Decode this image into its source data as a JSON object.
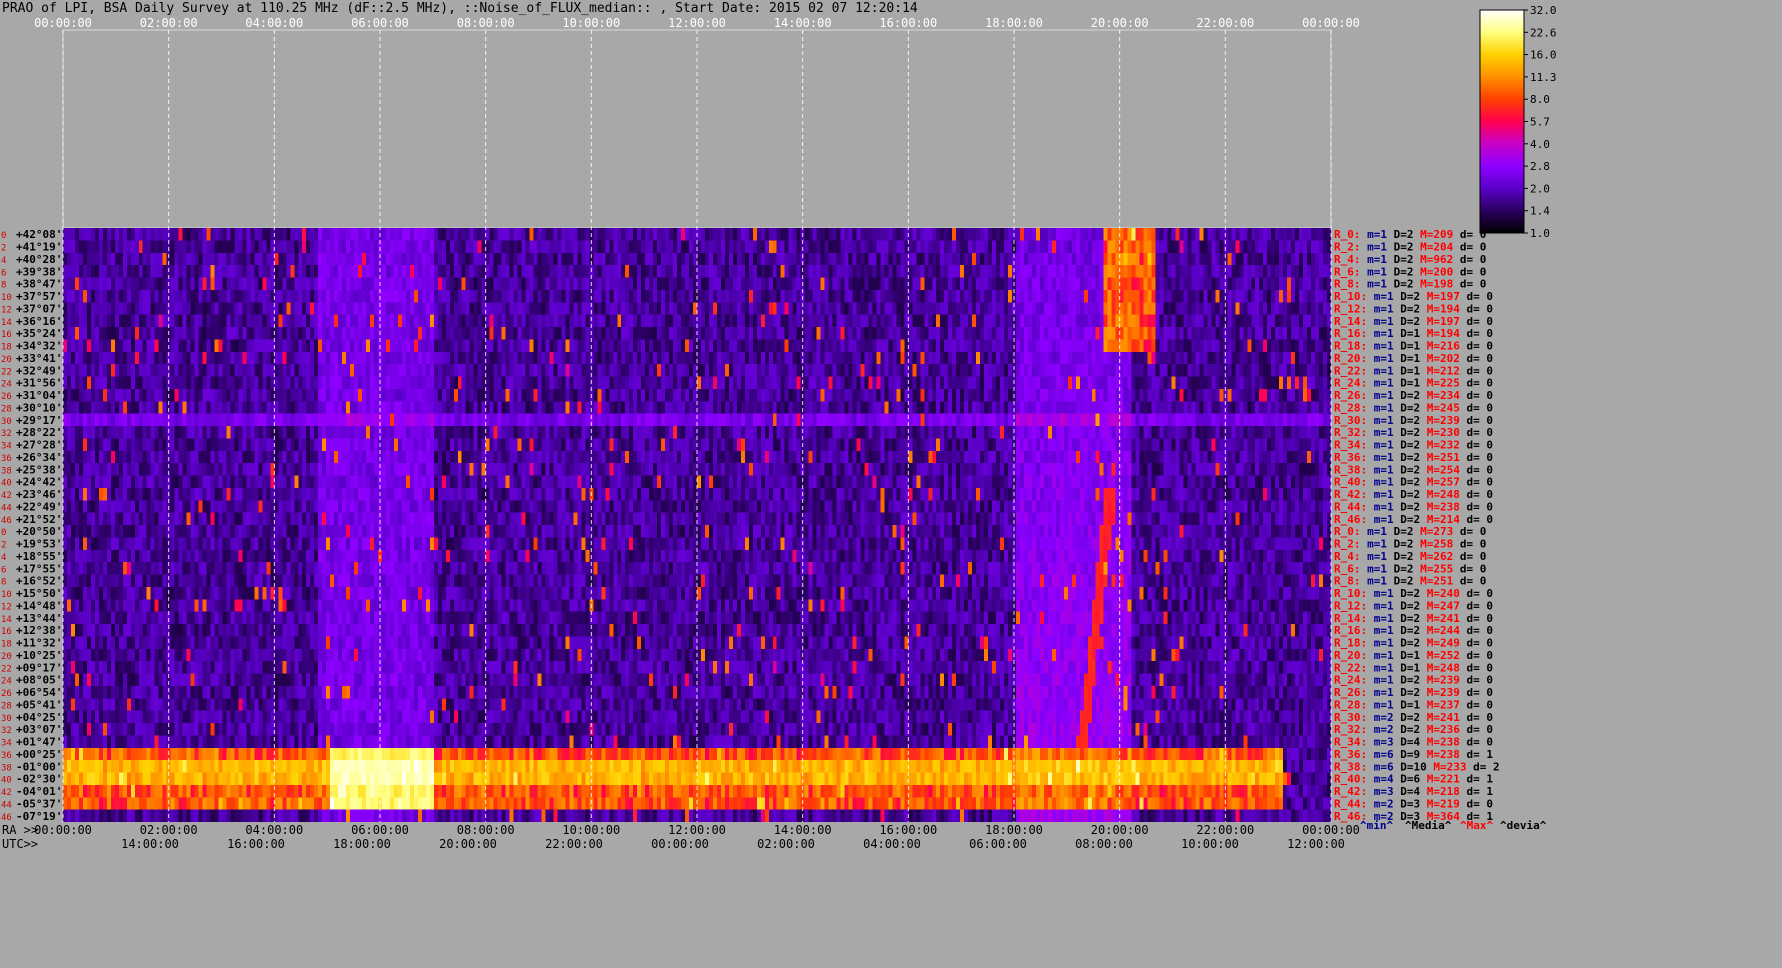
{
  "header": {
    "title": "PRAO of LPI, BSA Daily Survey at 110.25 MHz (dF::2.5 MHz), ::Noise_of_FLUX_median:: , Start Date: 2015 02 07 12:20:14"
  },
  "chart_data": {
    "type": "heatmap",
    "title": "PRAO of LPI, BSA Daily Survey at 110.25 MHz (dF::2.5 MHz), ::Noise_of_FLUX_median:: , Start Date: 2015 02 07 12:20:14",
    "x_top_ticks": [
      "00:00:00",
      "02:00:00",
      "04:00:00",
      "06:00:00",
      "08:00:00",
      "10:00:00",
      "12:00:00",
      "14:00:00",
      "16:00:00",
      "18:00:00",
      "20:00:00",
      "22:00:00",
      "00:00:00"
    ],
    "x_ra_prefix": "RA >>",
    "x_ra_ticks": [
      "00:00:00",
      "02:00:00",
      "04:00:00",
      "06:00:00",
      "08:00:00",
      "10:00:00",
      "12:00:00",
      "14:00:00",
      "16:00:00",
      "18:00:00",
      "20:00:00",
      "22:00:00",
      "00:00:00"
    ],
    "x_utc_prefix": "UTC>>",
    "x_utc_ticks": [
      "14:00:00",
      "16:00:00",
      "18:00:00",
      "20:00:00",
      "22:00:00",
      "00:00:00",
      "02:00:00",
      "04:00:00",
      "06:00:00",
      "08:00:00",
      "10:00:00",
      "12:00:00"
    ],
    "declinations": [
      "+42°08'",
      "+41°19'",
      "+40°28'",
      "+39°38'",
      "+38°47'",
      "+37°57'",
      "+37°07'",
      "+36°16'",
      "+35°24'",
      "+34°32'",
      "+33°41'",
      "+32°49'",
      "+31°56'",
      "+31°04'",
      "+30°10'",
      "+29°17'",
      "+28°22'",
      "+27°28'",
      "+26°34'",
      "+25°38'",
      "+24°42'",
      "+23°46'",
      "+22°49'",
      "+21°52'",
      "+20°50'",
      "+19°53'",
      "+18°55'",
      "+17°55'",
      "+16°52'",
      "+15°50'",
      "+14°48'",
      "+13°44'",
      "+12°38'",
      "+11°32'",
      "+10°25'",
      "+09°17'",
      "+08°05'",
      "+06°54'",
      "+05°41'",
      "+04°25'",
      "+03°07'",
      "+01°47'",
      "+00°25'",
      "-01°00'",
      "-02°30'",
      "-04°01'",
      "-05°37'",
      "-07°19'"
    ],
    "row_index_labels": [
      "0",
      "2",
      "4",
      "6",
      "8",
      "10",
      "12",
      "14",
      "16",
      "18",
      "20",
      "22",
      "24",
      "26",
      "28",
      "30",
      "32",
      "34",
      "36",
      "38",
      "40",
      "42",
      "44",
      "46",
      "0",
      "2",
      "4",
      "6",
      "8",
      "10",
      "12",
      "14",
      "16",
      "18",
      "20",
      "22",
      "24",
      "26",
      "28",
      "30",
      "32",
      "34",
      "36",
      "38",
      "40",
      "42",
      "44",
      "46"
    ],
    "row_stats": [
      {
        "r": "R_0:",
        "m": "m=1",
        "D": "D=2",
        "M": "M=209",
        "d": "d= 0"
      },
      {
        "r": "R_2:",
        "m": "m=1",
        "D": "D=2",
        "M": "M=204",
        "d": "d= 0"
      },
      {
        "r": "R_4:",
        "m": "m=1",
        "D": "D=2",
        "M": "M=962",
        "d": "d= 0"
      },
      {
        "r": "R_6:",
        "m": "m=1",
        "D": "D=2",
        "M": "M=200",
        "d": "d= 0"
      },
      {
        "r": "R_8:",
        "m": "m=1",
        "D": "D=2",
        "M": "M=198",
        "d": "d= 0"
      },
      {
        "r": "R_10:",
        "m": "m=1",
        "D": "D=2",
        "M": "M=197",
        "d": "d= 0"
      },
      {
        "r": "R_12:",
        "m": "m=1",
        "D": "D=2",
        "M": "M=194",
        "d": "d= 0"
      },
      {
        "r": "R_14:",
        "m": "m=1",
        "D": "D=2",
        "M": "M=197",
        "d": "d= 0"
      },
      {
        "r": "R_16:",
        "m": "m=1",
        "D": "D=1",
        "M": "M=194",
        "d": "d= 0"
      },
      {
        "r": "R_18:",
        "m": "m=1",
        "D": "D=1",
        "M": "M=216",
        "d": "d= 0"
      },
      {
        "r": "R_20:",
        "m": "m=1",
        "D": "D=1",
        "M": "M=202",
        "d": "d= 0"
      },
      {
        "r": "R_22:",
        "m": "m=1",
        "D": "D=1",
        "M": "M=212",
        "d": "d= 0"
      },
      {
        "r": "R_24:",
        "m": "m=1",
        "D": "D=1",
        "M": "M=225",
        "d": "d= 0"
      },
      {
        "r": "R_26:",
        "m": "m=1",
        "D": "D=2",
        "M": "M=234",
        "d": "d= 0"
      },
      {
        "r": "R_28:",
        "m": "m=1",
        "D": "D=2",
        "M": "M=245",
        "d": "d= 0"
      },
      {
        "r": "R_30:",
        "m": "m=1",
        "D": "D=2",
        "M": "M=239",
        "d": "d= 0"
      },
      {
        "r": "R_32:",
        "m": "m=1",
        "D": "D=2",
        "M": "M=230",
        "d": "d= 0"
      },
      {
        "r": "R_34:",
        "m": "m=1",
        "D": "D=2",
        "M": "M=232",
        "d": "d= 0"
      },
      {
        "r": "R_36:",
        "m": "m=1",
        "D": "D=2",
        "M": "M=251",
        "d": "d= 0"
      },
      {
        "r": "R_38:",
        "m": "m=1",
        "D": "D=2",
        "M": "M=254",
        "d": "d= 0"
      },
      {
        "r": "R_40:",
        "m": "m=1",
        "D": "D=2",
        "M": "M=257",
        "d": "d= 0"
      },
      {
        "r": "R_42:",
        "m": "m=1",
        "D": "D=2",
        "M": "M=248",
        "d": "d= 0"
      },
      {
        "r": "R_44:",
        "m": "m=1",
        "D": "D=2",
        "M": "M=238",
        "d": "d= 0"
      },
      {
        "r": "R_46:",
        "m": "m=1",
        "D": "D=2",
        "M": "M=214",
        "d": "d= 0"
      },
      {
        "r": "R_0:",
        "m": "m=1",
        "D": "D=2",
        "M": "M=273",
        "d": "d= 0"
      },
      {
        "r": "R_2:",
        "m": "m=1",
        "D": "D=2",
        "M": "M=258",
        "d": "d= 0"
      },
      {
        "r": "R_4:",
        "m": "m=1",
        "D": "D=2",
        "M": "M=262",
        "d": "d= 0"
      },
      {
        "r": "R_6:",
        "m": "m=1",
        "D": "D=2",
        "M": "M=255",
        "d": "d= 0"
      },
      {
        "r": "R_8:",
        "m": "m=1",
        "D": "D=2",
        "M": "M=251",
        "d": "d= 0"
      },
      {
        "r": "R_10:",
        "m": "m=1",
        "D": "D=2",
        "M": "M=240",
        "d": "d= 0"
      },
      {
        "r": "R_12:",
        "m": "m=1",
        "D": "D=2",
        "M": "M=247",
        "d": "d= 0"
      },
      {
        "r": "R_14:",
        "m": "m=1",
        "D": "D=2",
        "M": "M=241",
        "d": "d= 0"
      },
      {
        "r": "R_16:",
        "m": "m=1",
        "D": "D=2",
        "M": "M=244",
        "d": "d= 0"
      },
      {
        "r": "R_18:",
        "m": "m=1",
        "D": "D=2",
        "M": "M=249",
        "d": "d= 0"
      },
      {
        "r": "R_20:",
        "m": "m=1",
        "D": "D=1",
        "M": "M=252",
        "d": "d= 0"
      },
      {
        "r": "R_22:",
        "m": "m=1",
        "D": "D=1",
        "M": "M=248",
        "d": "d= 0"
      },
      {
        "r": "R_24:",
        "m": "m=1",
        "D": "D=2",
        "M": "M=239",
        "d": "d= 0"
      },
      {
        "r": "R_26:",
        "m": "m=1",
        "D": "D=2",
        "M": "M=239",
        "d": "d= 0"
      },
      {
        "r": "R_28:",
        "m": "m=1",
        "D": "D=1",
        "M": "M=237",
        "d": "d= 0"
      },
      {
        "r": "R_30:",
        "m": "m=2",
        "D": "D=2",
        "M": "M=241",
        "d": "d= 0"
      },
      {
        "r": "R_32:",
        "m": "m=2",
        "D": "D=2",
        "M": "M=236",
        "d": "d= 0"
      },
      {
        "r": "R_34:",
        "m": "m=3",
        "D": "D=4",
        "M": "M=238",
        "d": "d= 0"
      },
      {
        "r": "R_36:",
        "m": "m=6",
        "D": "D=9",
        "M": "M=238",
        "d": "d= 1"
      },
      {
        "r": "R_38:",
        "m": "m=6",
        "D": "D=10",
        "M": "M=233",
        "d": "d= 2"
      },
      {
        "r": "R_40:",
        "m": "m=4",
        "D": "D=6",
        "M": "M=221",
        "d": "d= 1"
      },
      {
        "r": "R_42:",
        "m": "m=3",
        "D": "D=4",
        "M": "M=218",
        "d": "d= 1"
      },
      {
        "r": "R_44:",
        "m": "m=2",
        "D": "D=3",
        "M": "M=219",
        "d": "d= 0"
      },
      {
        "r": "R_46:",
        "m": "m=2",
        "D": "D=3",
        "M": "M=364",
        "d": "d= 1"
      }
    ],
    "stats_legend": [
      "^min^",
      "^Media^",
      "^Max^",
      "^devia^"
    ],
    "colorbar_ticks": [
      "32.0",
      "22.6",
      "16.0",
      "11.3",
      "8.0",
      "5.7",
      "4.0",
      "2.8",
      "2.0",
      "1.4",
      "1.0"
    ],
    "colorbar_range": [
      1.0,
      32.0
    ],
    "colorbar_scale": "log",
    "colors": {
      "cmap": [
        "#000000",
        "#2a0060",
        "#5a00c8",
        "#8c00ff",
        "#c800c8",
        "#ff0050",
        "#ff4000",
        "#ff9000",
        "#ffd000",
        "#ffff80",
        "#ffffff"
      ],
      "background": "#a8a8a8",
      "grid": "#ffffff",
      "stat_red": "#ff0000",
      "stat_blue": "#00008b"
    }
  }
}
